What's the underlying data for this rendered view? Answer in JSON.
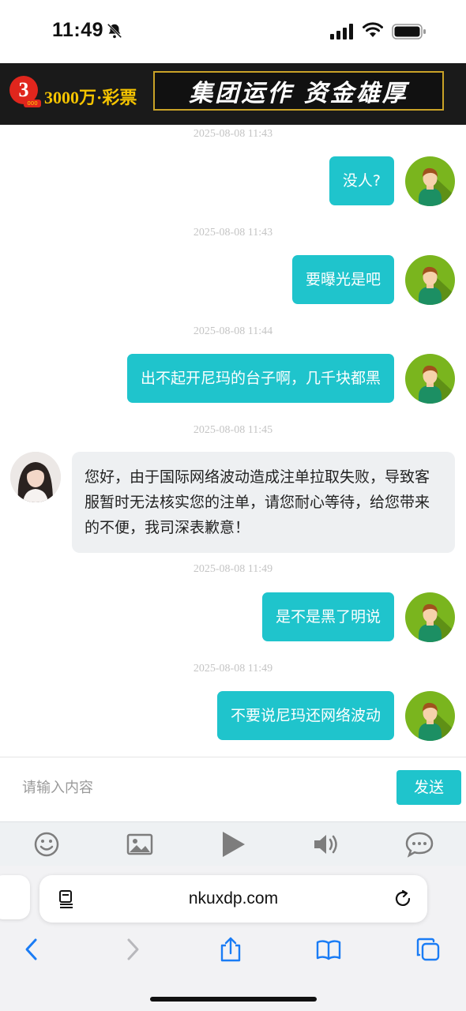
{
  "status_bar": {
    "time": "11:49"
  },
  "banner": {
    "logo_number": "3",
    "logo_badge": "000",
    "logo_text": "3000万·彩票",
    "slogan": "集团运作 资金雄厚"
  },
  "messages": [
    {
      "timestamp": "2025-08-08 11:43",
      "from": "user",
      "text": "没人?"
    },
    {
      "timestamp": "2025-08-08 11:43",
      "from": "user",
      "text": "要曝光是吧"
    },
    {
      "timestamp": "2025-08-08 11:44",
      "from": "user",
      "text": "出不起开尼玛的台子啊，几千块都黑"
    },
    {
      "timestamp": "2025-08-08 11:45",
      "from": "agent",
      "text": "您好，由于国际网络波动造成注单拉取失败，导致客服暂时无法核实您的注单，请您耐心等待，给您带来的不便，我司深表歉意！"
    },
    {
      "timestamp": "2025-08-08 11:49",
      "from": "user",
      "text": "是不是黑了明说"
    },
    {
      "timestamp": "2025-08-08 11:49",
      "from": "user",
      "text": "不要说尼玛还网络波动"
    }
  ],
  "input": {
    "placeholder": "请输入内容",
    "send_label": "发送"
  },
  "toolbar": {
    "icons": [
      "emoji-icon",
      "image-icon",
      "play-icon",
      "speaker-icon",
      "chat-bubble-icon"
    ]
  },
  "browser": {
    "url": "nkuxdp.com"
  },
  "colors": {
    "accent": "#1fc4cc",
    "user_avatar_bg": "#7ab51e",
    "agent_bubble_bg": "#eef0f2",
    "timestamp": "#c4c4c4"
  }
}
